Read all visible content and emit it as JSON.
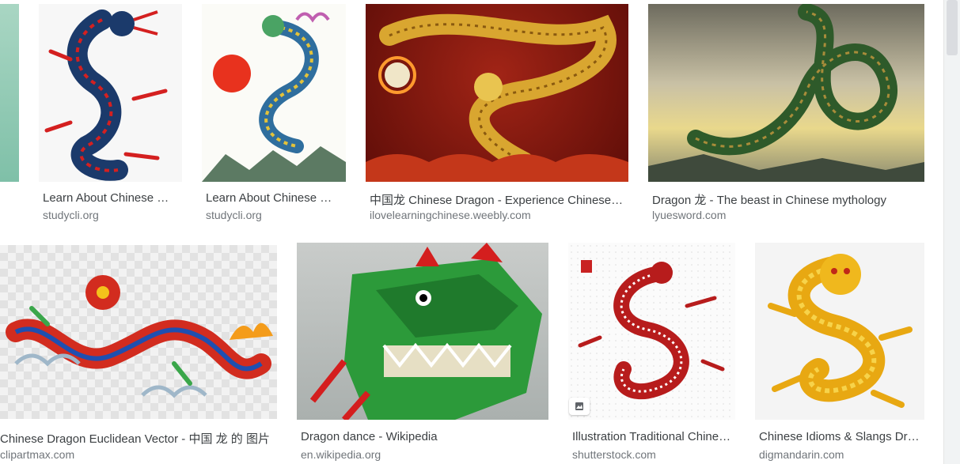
{
  "colors": {
    "title_text": "#3c4043",
    "source_text": "#70757a",
    "scrollbar_track": "#f1f3f4",
    "scrollbar_thumb": "#dadce0"
  },
  "results": {
    "row1": [
      {
        "title": "",
        "source": "",
        "icon": "partial-thumbnail"
      },
      {
        "title": "Learn About Chinese Dragons",
        "source": "studycli.org",
        "icon": "blue-red-dragon-thumbnail"
      },
      {
        "title": "Learn About Chinese Dragons",
        "source": "studycli.org",
        "icon": "colorful-dragon-sun-thumbnail"
      },
      {
        "title": "中国龙 Chinese Dragon - Experience Chinese Culture",
        "source": "ilovelearningchinese.weebly.com",
        "icon": "golden-dragon-red-thumbnail"
      },
      {
        "title": "Dragon 龙 - The beast in Chinese mythology",
        "source": "lyuesword.com",
        "icon": "green-dragon-clouds-thumbnail"
      }
    ],
    "row2": [
      {
        "title": "Chinese Dragon Euclidean Vector - 中国 龙 的 图片",
        "source": "clipartmax.com",
        "icon": "red-clipart-dragon-thumbnail"
      },
      {
        "title": "Dragon dance - Wikipedia",
        "source": "en.wikipedia.org",
        "icon": "dragon-dance-thumbnail"
      },
      {
        "title": "Illustration Traditional Chinese Dragon",
        "source": "shutterstock.com",
        "icon": "red-line-dragon-thumbnail",
        "badge": "image-icon"
      },
      {
        "title": "Chinese Idioms & Slangs Dragon",
        "source": "digmandarin.com",
        "icon": "golden-dragon-thumbnail"
      }
    ]
  }
}
